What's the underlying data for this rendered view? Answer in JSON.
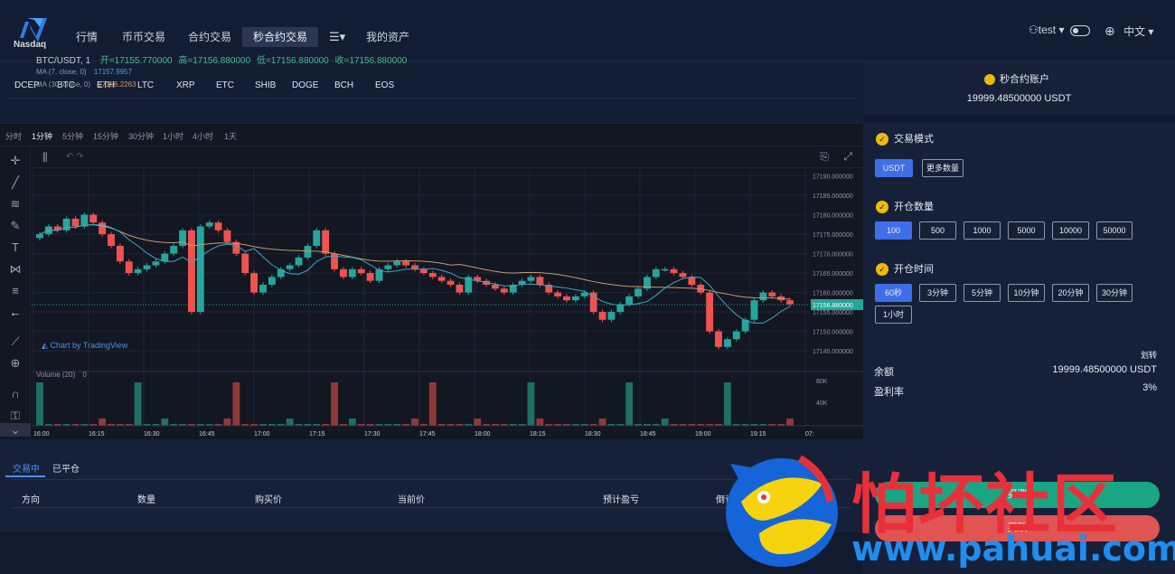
{
  "nav": {
    "logo_text": "Nasdaq",
    "items": [
      "行情",
      "币币交易",
      "合约交易",
      "秒合约交易",
      "我的资产"
    ],
    "user": "test",
    "language": "中文"
  },
  "coins": [
    "DCEP",
    "BTC",
    "ETH",
    "LTC",
    "XRP",
    "ETC",
    "SHIB",
    "DOGE",
    "BCH",
    "EOS"
  ],
  "chart": {
    "intervals": [
      "分时",
      "1分钟",
      "5分钟",
      "15分钟",
      "30分钟",
      "1小时",
      "4小时",
      "1天"
    ],
    "active_interval": "1分钟",
    "symbol": "BTC/USDT, 1",
    "open_label": "开=17155.770000",
    "high_label": "高=17156.880000",
    "low_label": "低=17156.880000",
    "close_label": "收=17156.880000",
    "ma7_label": "MA (7, close, 0)",
    "ma7_value": "17157.9957",
    "ma30_label": "MA (30, close, 0)",
    "ma30_value": "17156.2263",
    "badge": "Chart by TradingView",
    "volume_label": "Volume (20)",
    "volume_value": "0",
    "price_ticks": [
      "17190.000000",
      "17185.000000",
      "17180.000000",
      "17175.000000",
      "17170.000000",
      "17165.000000",
      "17160.000000",
      "17155.000000",
      "17150.000000",
      "17145.000000"
    ],
    "last_price": "17156.880000",
    "volume_ticks": [
      "80K",
      "40K"
    ],
    "time_ticks": [
      "16:00",
      "16:15",
      "16:30",
      "16:45",
      "17:00",
      "17:15",
      "17:30",
      "17:45",
      "18:00",
      "18:15",
      "18:30",
      "18:45",
      "19:00",
      "19:15",
      "07:"
    ]
  },
  "chart_data": {
    "type": "candlestick",
    "x_range": [
      "16:00",
      "19:25"
    ],
    "ylim": [
      17142,
      17192
    ],
    "candles_close": [
      17175,
      17177,
      17176,
      17179,
      17177,
      17180,
      17178,
      17175,
      17172,
      17168,
      17165,
      17166,
      17167,
      17168,
      17170,
      17172,
      17176,
      17155,
      17177,
      17178,
      17176,
      17173,
      17170,
      17165,
      17160,
      17162,
      17164,
      17166,
      17167,
      17169,
      17172,
      17176,
      17170,
      17166,
      17164,
      17166,
      17165,
      17163,
      17166,
      17167,
      17168,
      17167,
      17166,
      17165,
      17164,
      17163,
      17162,
      17160,
      17164,
      17163,
      17162,
      17161,
      17160,
      17162,
      17163,
      17164,
      17162,
      17160,
      17159,
      17158,
      17159,
      17160,
      17155,
      17153,
      17155,
      17157,
      17159,
      17161,
      17164,
      17166,
      17166,
      17165,
      17164,
      17162,
      17160,
      17150,
      17146,
      17148,
      17150,
      17153,
      17158,
      17160,
      17159,
      17158,
      17157
    ],
    "ma7": 17157.9957,
    "ma30": 17156.2263,
    "last": 17156.88
  },
  "positions": {
    "tabs": [
      "交易中",
      "已平仓"
    ],
    "columns": [
      "方向",
      "数量",
      "购买价",
      "当前价",
      "预计盈亏",
      "倒计时"
    ]
  },
  "side": {
    "account_title": "秒合约账户",
    "account_balance": "19999.48500000 USDT",
    "mode_label": "交易模式",
    "mode_options": [
      "USDT",
      "更多数量"
    ],
    "qty_label": "开仓数量",
    "qty_options": [
      "100",
      "500",
      "1000",
      "5000",
      "10000",
      "50000"
    ],
    "time_label": "开仓时间",
    "time_options": [
      "60秒",
      "3分钟",
      "5分钟",
      "10分钟",
      "20分钟",
      "30分钟",
      "1小时"
    ],
    "transfer": "划转",
    "balance_label": "余额",
    "balance_value": "19999.48500000 USDT",
    "profit_label": "盈利率",
    "profit_value": "3%",
    "buy_label": "买涨",
    "sell_label": "买跌"
  },
  "watermark": {
    "cn": "怕坏社区",
    "url": "www.pahuai.com"
  }
}
